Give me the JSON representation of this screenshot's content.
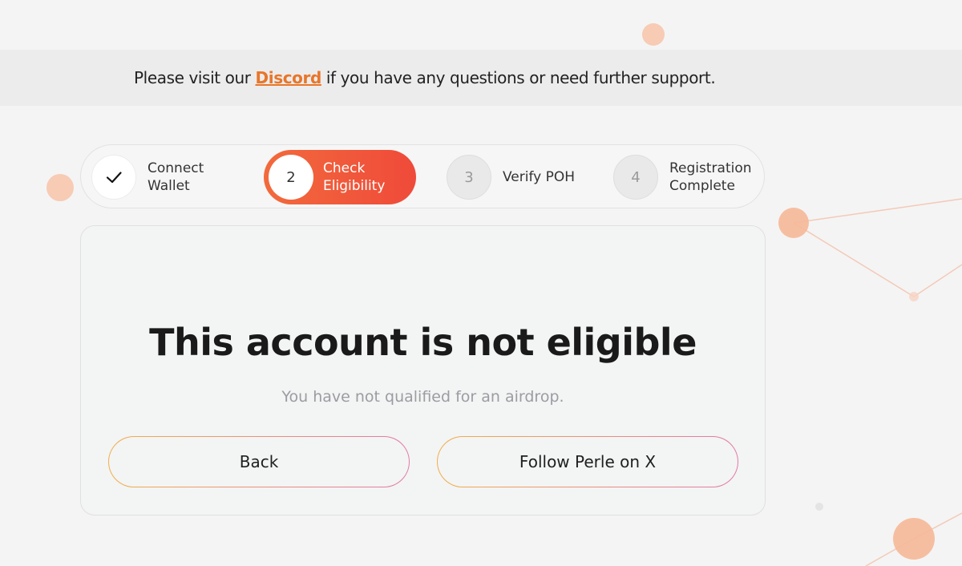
{
  "notice": {
    "before": "Please visit our ",
    "link": "Discord",
    "after": " if you have any questions or need further support."
  },
  "stepper": {
    "steps": [
      {
        "badge": "",
        "icon": "checkmark-icon",
        "line1": "Connect",
        "line2": "Wallet",
        "state": "completed"
      },
      {
        "badge": "2",
        "line1": "Check",
        "line2": "Eligibility",
        "state": "active"
      },
      {
        "badge": "3",
        "line1": "Verify POH",
        "line2": "",
        "state": "pending"
      },
      {
        "badge": "4",
        "line1": "Registration",
        "line2": "Complete",
        "state": "pending"
      }
    ]
  },
  "result": {
    "title": "This account is not eligible",
    "subtitle": "You have not qualified for an airdrop."
  },
  "actions": {
    "back": "Back",
    "follow": "Follow Perle on X"
  },
  "colors": {
    "accent_orange": "#f26a3c",
    "accent_red": "#ef4a3a",
    "link": "#e8762a",
    "subtitle_gray": "#9c9ca2"
  }
}
